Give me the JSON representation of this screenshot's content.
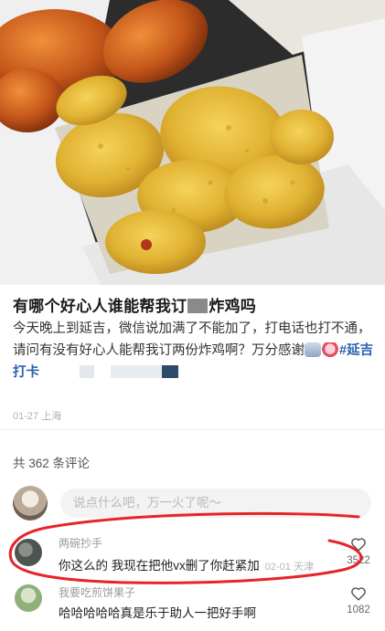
{
  "post": {
    "title_before": "有哪个好心人谁能帮我订",
    "title_after": "炸鸡吗",
    "body": "今天晚上到延吉，微信说加满了不能加了，打电话也打不通，请问有没有好心人能帮我订两份炸鸡啊？万分感谢",
    "hashtag": "#延吉打卡",
    "meta": "01-27 上海"
  },
  "comments_header": "共 362 条评论",
  "comment_input": {
    "placeholder": "说点什么吧，万一火了呢～"
  },
  "comments": [
    {
      "user": "两碗抄手",
      "text": "你这么的 我现在把他vx删了你赶紧加",
      "time": "02-01 天津",
      "likes": "3522"
    },
    {
      "user": "我要吃煎饼果子",
      "text": "哈哈哈哈哈真是乐于助人一把好手啊",
      "likes": "1082"
    }
  ],
  "icons": {
    "like": "heart-outline-icon"
  },
  "colors": {
    "hashtag": "#2a5fb0",
    "annotation": "#e8232a"
  }
}
